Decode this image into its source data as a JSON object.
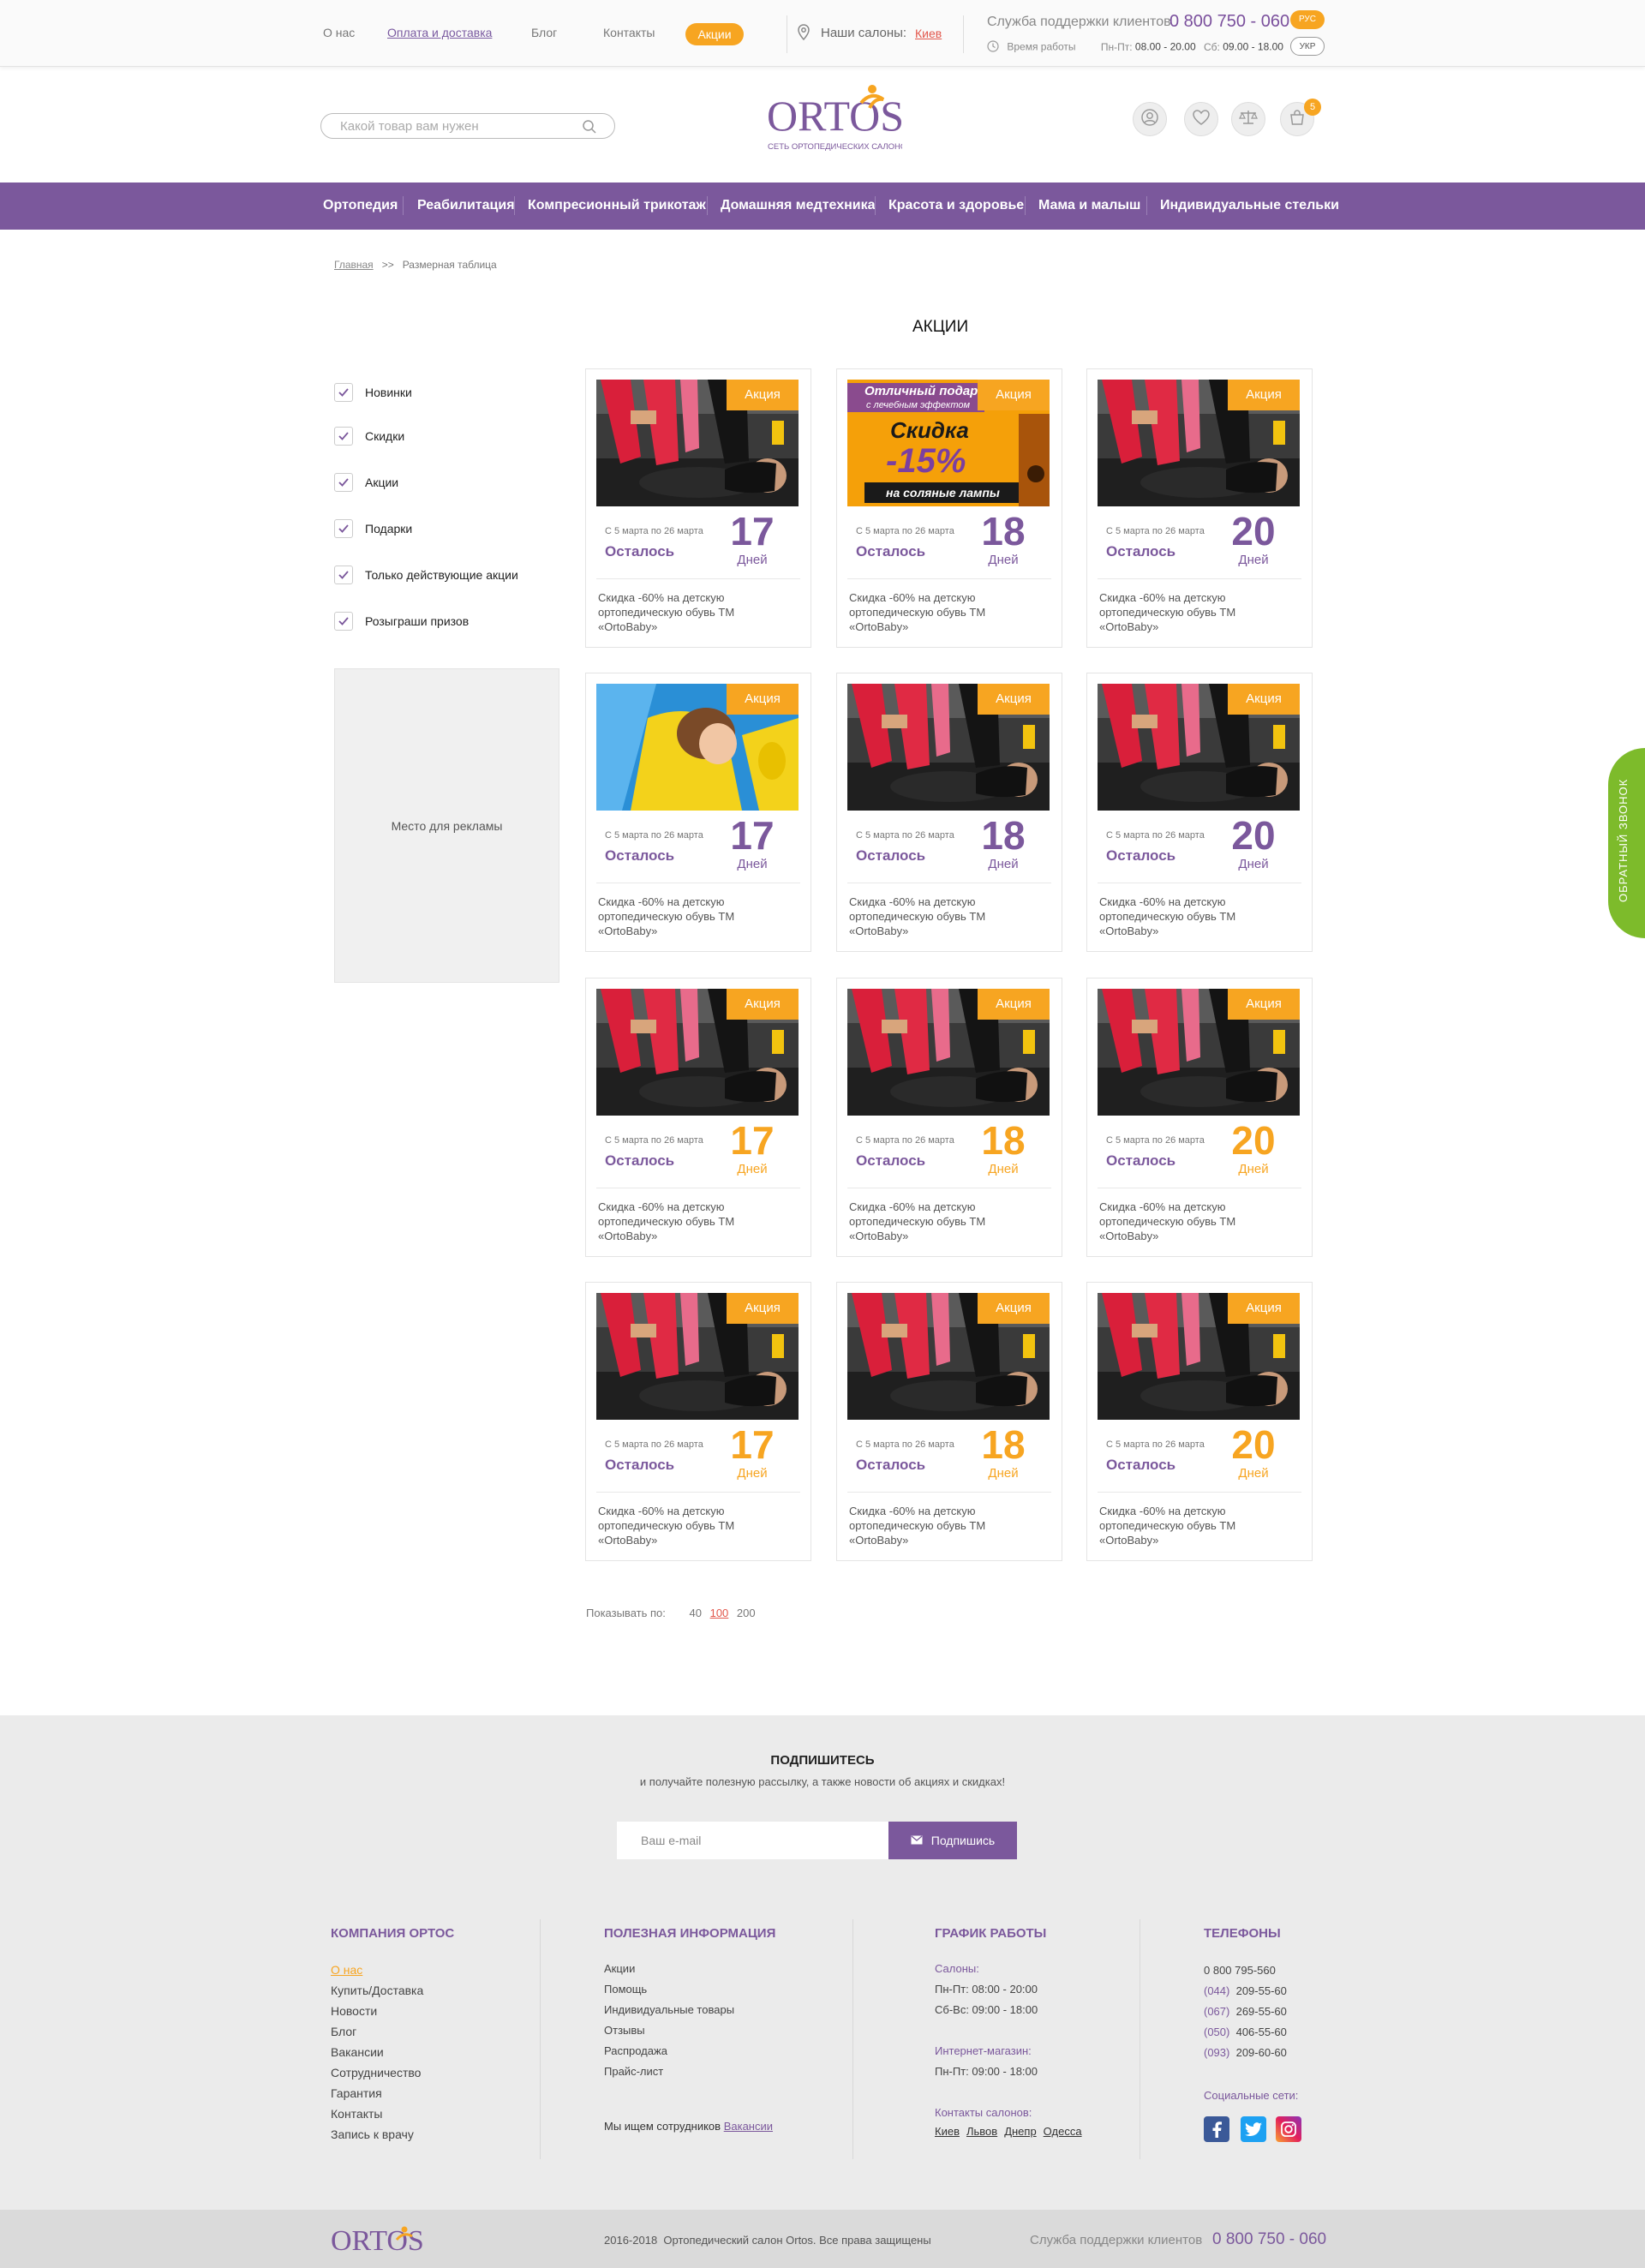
{
  "topbar": {
    "links": [
      "О нас",
      "Оплата и доставка",
      "Блог",
      "Контакты"
    ],
    "promo_pill": "Акции",
    "salons_label": "Наши салоны:",
    "salons_city": "Киев",
    "support_label": "Служба поддержки клиентов",
    "support_phone": "0 800 750 - 060",
    "hours_label": "Время работы",
    "hours_weekdays_label": "Пн-Пт:",
    "hours_weekdays": "08.00 - 20.00",
    "hours_sat_label": "Сб:",
    "hours_sat": "09.00 - 18.00",
    "lang_active": "РУС",
    "lang_inactive": "УКР"
  },
  "header": {
    "search_placeholder": "Какой товар вам нужен",
    "logo_text": "ORTOS",
    "logo_tagline": "СЕТЬ ОРТОПЕДИЧЕСКИХ САЛОНОВ",
    "cart_count": "5"
  },
  "nav": {
    "items": [
      "Ортопедия",
      "Реабилитация",
      "Компресионный трикотаж",
      "Домашняя медтехника",
      "Красота и здоровье",
      "Мама и малыш",
      "Индивидуальные стельки"
    ]
  },
  "breadcrumb": {
    "home": "Главная",
    "separator": ">>",
    "current": "Размерная таблица"
  },
  "page_title": "АКЦИИ",
  "filters": [
    "Новинки",
    "Скидки",
    "Акции",
    "Подарки",
    "Только действующие акции",
    "Розыграши призов"
  ],
  "ad_text": "Место для рекламы",
  "card_common": {
    "badge": "Акция",
    "dates": "С 5 марта по 26 марта",
    "left_label": "Осталось",
    "days_label": "Дней",
    "desc": "Скидка -60% на детскую ортопедическую обувь ТМ «OrtoBaby»"
  },
  "banner": {
    "line1": "Отличный подарок",
    "line2": "с лечебным эффектом",
    "line3": "Скидка",
    "line4": "-15%",
    "line5": "на соляные лампы"
  },
  "cards": [
    {
      "days": "17",
      "color": "purple",
      "image": "fitness"
    },
    {
      "days": "18",
      "color": "purple",
      "image": "banner"
    },
    {
      "days": "20",
      "color": "purple",
      "image": "fitness"
    },
    {
      "days": "17",
      "color": "purple",
      "image": "child"
    },
    {
      "days": "18",
      "color": "purple",
      "image": "fitness"
    },
    {
      "days": "20",
      "color": "purple",
      "image": "fitness"
    },
    {
      "days": "17",
      "color": "orange",
      "image": "fitness"
    },
    {
      "days": "18",
      "color": "orange",
      "image": "fitness"
    },
    {
      "days": "20",
      "color": "orange",
      "image": "fitness"
    },
    {
      "days": "17",
      "color": "orange",
      "image": "fitness"
    },
    {
      "days": "18",
      "color": "orange",
      "image": "fitness"
    },
    {
      "days": "20",
      "color": "orange",
      "image": "fitness"
    }
  ],
  "pager": {
    "label": "Показывать по:",
    "options": [
      "40",
      "100",
      "200"
    ],
    "selected": "100"
  },
  "subscribe": {
    "title": "ПОДПИШИТЕСЬ",
    "text": "и получайте полезную рассылку, а также новости об акциях и скидках!",
    "placeholder": "Ваш e-mail",
    "button": "Подпишись"
  },
  "footer": {
    "company_title": "КОМПАНИЯ ОРТОС",
    "company_links": [
      "О нас",
      "Купить/Доставка",
      "Новости",
      "Блог",
      "Вакансии",
      "Сотрудничество",
      "Гарантия",
      "Контакты",
      "Запись к врачу"
    ],
    "info_title": "ПОЛЕЗНАЯ ИНФОРМАЦИЯ",
    "info_links": [
      "Акции",
      "Помощь",
      "Индивидуальные товары",
      "Отзывы",
      "Распродажа",
      "Прайс-лист"
    ],
    "jobs_text": "Мы ищем сотрудников",
    "jobs_link": "Вакансии",
    "schedule_title": "ГРАФИК РАБОТЫ",
    "salons_label": "Салоны:",
    "salons_hours": [
      "Пн-Пт: 08:00 - 20:00",
      "Сб-Вс: 09:00 - 18:00"
    ],
    "shop_label": "Интернет-магазин:",
    "shop_hours": "Пн-Пт: 09:00 - 18:00",
    "contacts_label": "Контакты салонов:",
    "cities": [
      "Киев",
      "Львов",
      "Днепр",
      "Одесса"
    ],
    "phones_title": "ТЕЛЕФОНЫ",
    "phone_main": "0 800 795-560",
    "phones": [
      {
        "code": "(044)",
        "number": "209-55-60"
      },
      {
        "code": "(067)",
        "number": "269-55-60"
      },
      {
        "code": "(050)",
        "number": "406-55-60"
      },
      {
        "code": "(093)",
        "number": "209-60-60"
      }
    ],
    "social_label": "Социальные сети:"
  },
  "bottom": {
    "logo_text": "ORTOS",
    "copyright": "2016-2018  Ортопедический салон Ortos. Все права защищены",
    "support_label": "Служба поддержки клиентов",
    "support_phone": "0 800 750 - 060"
  },
  "callback_label": "ОБРАТНЫЙ ЗВОНОК",
  "colors": {
    "brand_purple": "#7b589c",
    "accent_orange": "#f7a521",
    "callback_green": "#7dbb2b"
  }
}
